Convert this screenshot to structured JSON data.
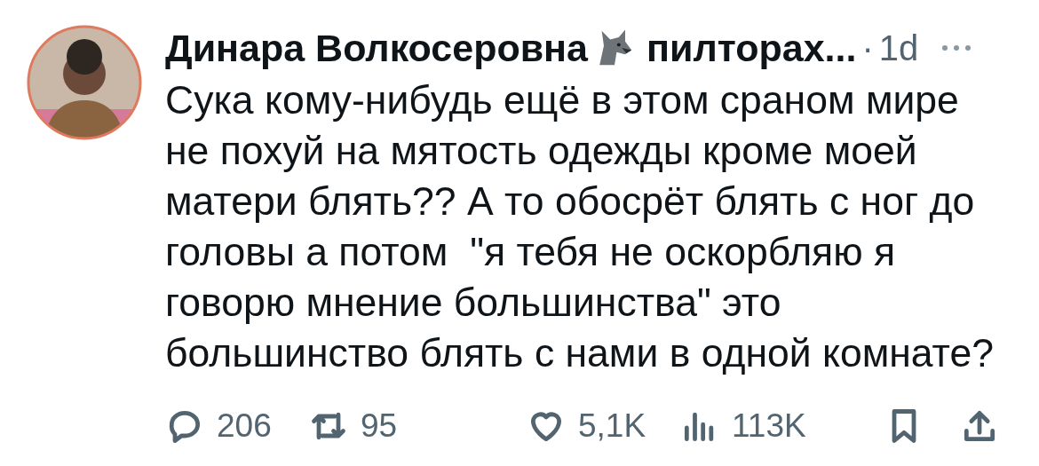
{
  "author": {
    "name": "Динара Волкосеровна",
    "handle": "пилторах...",
    "separator": "·",
    "time": "1d"
  },
  "text": "Сука кому-нибудь ещё в этом сраном мире\nне похуй на мятость одежды кроме моей\nматери блять?? А то обосрёт блять с ног до\nголовы а потом  \"я тебя не оскорбляю я\nговорю мнение большинства\" это\nбольшинство блять с нами в одной комнате?",
  "actions": [
    {
      "kind": "reply",
      "count": "206"
    },
    {
      "kind": "repost",
      "count": "95"
    },
    {
      "kind": "like",
      "count": "5,1K"
    },
    {
      "kind": "views",
      "count": "113K"
    },
    {
      "kind": "bookmark"
    },
    {
      "kind": "share"
    }
  ]
}
